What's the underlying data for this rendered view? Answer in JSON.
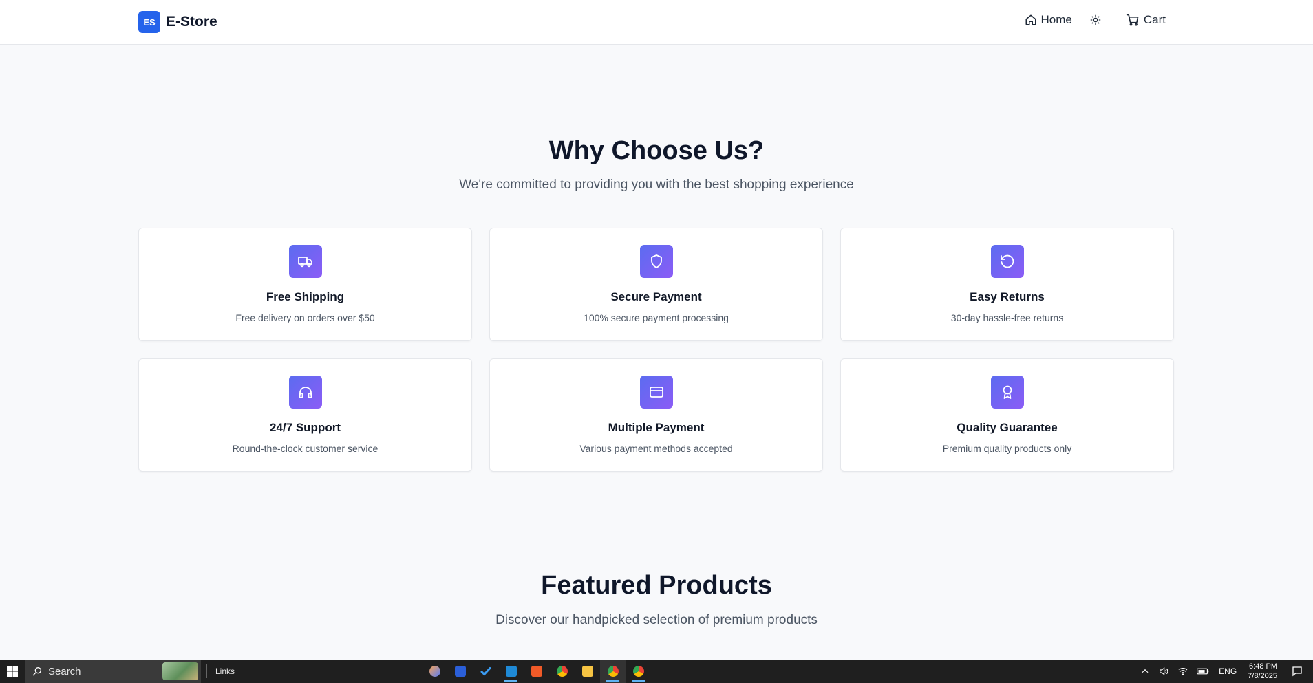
{
  "header": {
    "logo_text": "ES",
    "brand": "E-Store",
    "nav": {
      "home": "Home",
      "cart": "Cart"
    }
  },
  "why": {
    "title": "Why Choose Us?",
    "subtitle": "We're committed to providing you with the best shopping experience",
    "features": [
      {
        "title": "Free Shipping",
        "desc": "Free delivery on orders over $50",
        "icon": "truck-icon"
      },
      {
        "title": "Secure Payment",
        "desc": "100% secure payment processing",
        "icon": "shield-icon"
      },
      {
        "title": "Easy Returns",
        "desc": "30-day hassle-free returns",
        "icon": "rotate-ccw-icon"
      },
      {
        "title": "24/7 Support",
        "desc": "Round-the-clock customer service",
        "icon": "headphones-icon"
      },
      {
        "title": "Multiple Payment",
        "desc": "Various payment methods accepted",
        "icon": "credit-card-icon"
      },
      {
        "title": "Quality Guarantee",
        "desc": "Premium quality products only",
        "icon": "award-icon"
      }
    ]
  },
  "featured": {
    "title": "Featured Products",
    "subtitle": "Discover our handpicked selection of premium products"
  },
  "taskbar": {
    "search_placeholder": "Search",
    "links_label": "Links",
    "language": "ENG",
    "time": "6:48 PM",
    "date": "7/8/2025"
  },
  "colors": {
    "brand_blue": "#2563eb",
    "icon_gradient_start": "#5b6cf0",
    "icon_gradient_end": "#8b5cf6",
    "page_bg": "#f8f9fb"
  }
}
